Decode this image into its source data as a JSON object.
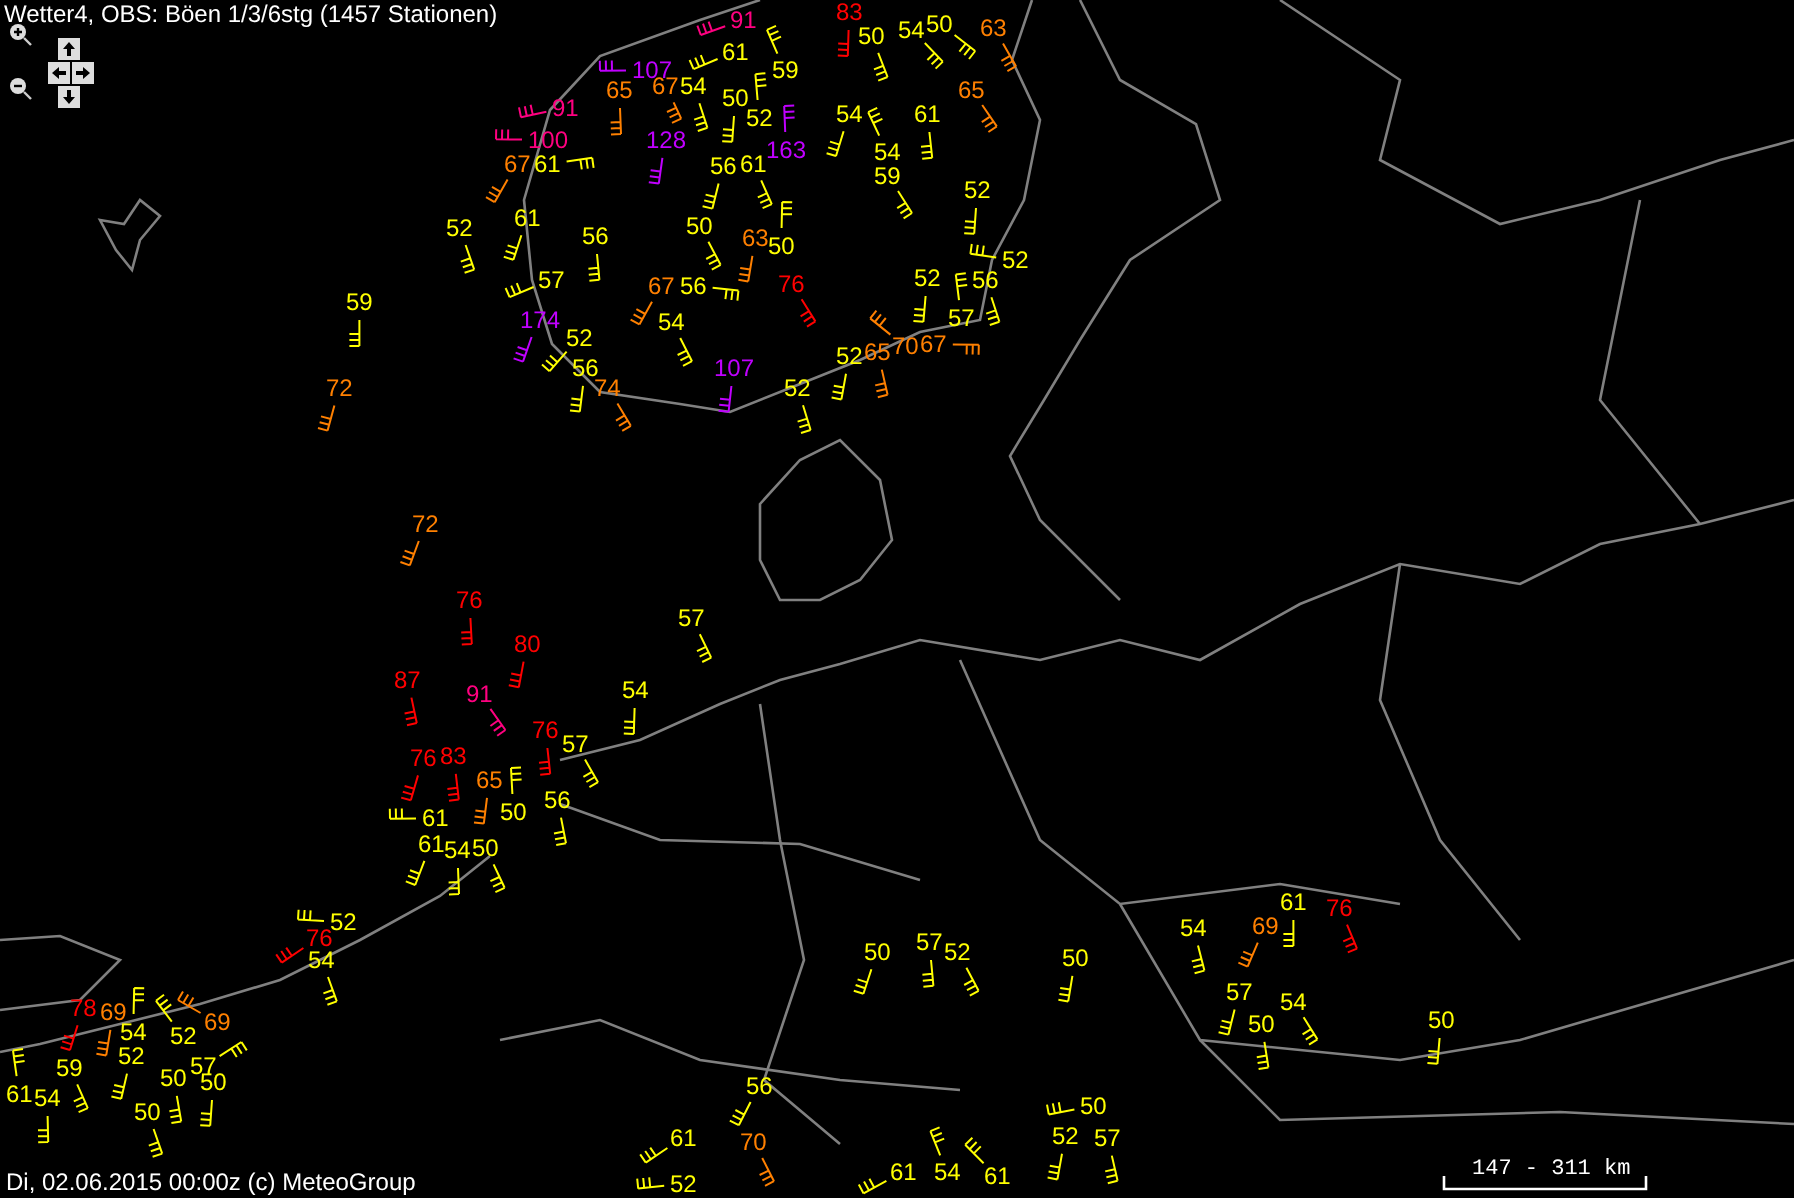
{
  "title": "Wetter4, OBS: Böen 1/3/6stg (1457 Stationen)",
  "stations": [
    {
      "value": "91",
      "color": "#ff0080"
    },
    {
      "value": "83",
      "color": "#ff0000"
    },
    {
      "value": "50",
      "color": "#ffff00"
    },
    {
      "value": "54",
      "color": "#ffff00"
    },
    {
      "value": "50",
      "color": "#ffff00"
    },
    {
      "value": "63",
      "color": "#ff8000"
    },
    {
      "value": "61",
      "color": "#ffff00"
    },
    {
      "value": "107",
      "color": "#c000ff"
    },
    {
      "value": "59",
      "color": "#ffff00"
    },
    {
      "value": "65",
      "color": "#ff8000"
    },
    {
      "value": "67",
      "color": "#ff8000"
    },
    {
      "value": "54",
      "color": "#ffff00"
    },
    {
      "value": "50",
      "color": "#ffff00"
    },
    {
      "value": "65",
      "color": "#ff8000"
    },
    {
      "value": "91",
      "color": "#ff0080"
    },
    {
      "value": "52",
      "color": "#ffff00"
    },
    {
      "value": "54",
      "color": "#ffff00"
    },
    {
      "value": "61",
      "color": "#ffff00"
    },
    {
      "value": "100",
      "color": "#ff0080"
    },
    {
      "value": "128",
      "color": "#c000ff"
    },
    {
      "value": "67",
      "color": "#ff8000"
    },
    {
      "value": "61",
      "color": "#ffff00"
    },
    {
      "value": "56",
      "color": "#ffff00"
    },
    {
      "value": "61",
      "color": "#ffff00"
    },
    {
      "value": "163",
      "color": "#c000ff"
    },
    {
      "value": "54",
      "color": "#ffff00"
    },
    {
      "value": "59",
      "color": "#ffff00"
    },
    {
      "value": "52",
      "color": "#ffff00"
    },
    {
      "value": "52",
      "color": "#ffff00"
    },
    {
      "value": "61",
      "color": "#ffff00"
    },
    {
      "value": "56",
      "color": "#ffff00"
    },
    {
      "value": "50",
      "color": "#ffff00"
    },
    {
      "value": "63",
      "color": "#ff8000"
    },
    {
      "value": "50",
      "color": "#ffff00"
    },
    {
      "value": "52",
      "color": "#ffff00"
    },
    {
      "value": "59",
      "color": "#ffff00"
    },
    {
      "value": "57",
      "color": "#ffff00"
    },
    {
      "value": "67",
      "color": "#ff8000"
    },
    {
      "value": "56",
      "color": "#ffff00"
    },
    {
      "value": "76",
      "color": "#ff0000"
    },
    {
      "value": "52",
      "color": "#ffff00"
    },
    {
      "value": "56",
      "color": "#ffff00"
    },
    {
      "value": "174",
      "color": "#c000ff"
    },
    {
      "value": "52",
      "color": "#ffff00"
    },
    {
      "value": "54",
      "color": "#ffff00"
    },
    {
      "value": "52",
      "color": "#ffff00"
    },
    {
      "value": "65",
      "color": "#ff8000"
    },
    {
      "value": "70",
      "color": "#ff8000"
    },
    {
      "value": "67",
      "color": "#ff8000"
    },
    {
      "value": "57",
      "color": "#ffff00"
    },
    {
      "value": "72",
      "color": "#ff8000"
    },
    {
      "value": "56",
      "color": "#ffff00"
    },
    {
      "value": "74",
      "color": "#ff8000"
    },
    {
      "value": "107",
      "color": "#c000ff"
    },
    {
      "value": "52",
      "color": "#ffff00"
    },
    {
      "value": "72",
      "color": "#ff8000"
    },
    {
      "value": "76",
      "color": "#ff0000"
    },
    {
      "value": "57",
      "color": "#ffff00"
    },
    {
      "value": "80",
      "color": "#ff0000"
    },
    {
      "value": "87",
      "color": "#ff0000"
    },
    {
      "value": "91",
      "color": "#ff0080"
    },
    {
      "value": "54",
      "color": "#ffff00"
    },
    {
      "value": "76",
      "color": "#ff0000"
    },
    {
      "value": "76",
      "color": "#ff0000"
    },
    {
      "value": "83",
      "color": "#ff0000"
    },
    {
      "value": "57",
      "color": "#ffff00"
    },
    {
      "value": "65",
      "color": "#ff8000"
    },
    {
      "value": "61",
      "color": "#ffff00"
    },
    {
      "value": "61",
      "color": "#ffff00"
    },
    {
      "value": "54",
      "color": "#ffff00"
    },
    {
      "value": "50",
      "color": "#ffff00"
    },
    {
      "value": "50",
      "color": "#ffff00"
    },
    {
      "value": "56",
      "color": "#ffff00"
    },
    {
      "value": "76",
      "color": "#ff0000"
    },
    {
      "value": "52",
      "color": "#ffff00"
    },
    {
      "value": "54",
      "color": "#ffff00"
    },
    {
      "value": "78",
      "color": "#ff0000"
    },
    {
      "value": "69",
      "color": "#ff8000"
    },
    {
      "value": "54",
      "color": "#ffff00"
    },
    {
      "value": "52",
      "color": "#ffff00"
    },
    {
      "value": "69",
      "color": "#ff8000"
    },
    {
      "value": "61",
      "color": "#ffff00"
    },
    {
      "value": "54",
      "color": "#ffff00"
    },
    {
      "value": "59",
      "color": "#ffff00"
    },
    {
      "value": "52",
      "color": "#ffff00"
    },
    {
      "value": "50",
      "color": "#ffff00"
    },
    {
      "value": "57",
      "color": "#ffff00"
    },
    {
      "value": "50",
      "color": "#ffff00"
    },
    {
      "value": "50",
      "color": "#ffff00"
    },
    {
      "value": "50",
      "color": "#ffff00"
    },
    {
      "value": "57",
      "color": "#ffff00"
    },
    {
      "value": "52",
      "color": "#ffff00"
    },
    {
      "value": "50",
      "color": "#ffff00"
    },
    {
      "value": "54",
      "color": "#ffff00"
    },
    {
      "value": "69",
      "color": "#ff8000"
    },
    {
      "value": "61",
      "color": "#ffff00"
    },
    {
      "value": "76",
      "color": "#ff0000"
    },
    {
      "value": "57",
      "color": "#ffff00"
    },
    {
      "value": "50",
      "color": "#ffff00"
    },
    {
      "value": "54",
      "color": "#ffff00"
    },
    {
      "value": "50",
      "color": "#ffff00"
    },
    {
      "value": "56",
      "color": "#ffff00"
    },
    {
      "value": "50",
      "color": "#ffff00"
    },
    {
      "value": "61",
      "color": "#ffff00"
    },
    {
      "value": "70",
      "color": "#ff8000"
    },
    {
      "value": "52",
      "color": "#ffff00"
    },
    {
      "value": "57",
      "color": "#ffff00"
    },
    {
      "value": "52",
      "color": "#ffff00"
    },
    {
      "value": "61",
      "color": "#ffff00"
    },
    {
      "value": "54",
      "color": "#ffff00"
    },
    {
      "value": "61",
      "color": "#ffff00"
    }
  ],
  "footer": "Di, 02.06.2015 00:00z (c) MeteoGroup",
  "scale": "147 - 311 km"
}
